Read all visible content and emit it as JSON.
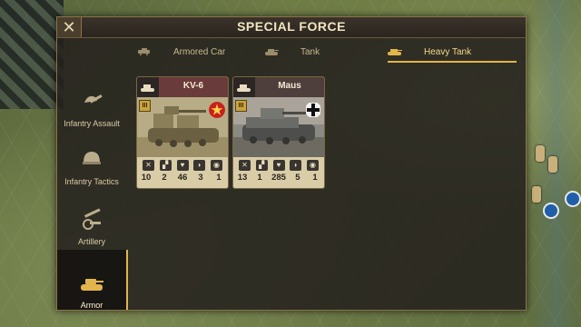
{
  "window": {
    "title": "SPECIAL FORCE",
    "close_glyph": "✕"
  },
  "tabs": [
    {
      "label": "Armored Car",
      "icon": "armored-car-icon",
      "active": false
    },
    {
      "label": "Tank",
      "icon": "tank-icon",
      "active": false
    },
    {
      "label": "Heavy Tank",
      "icon": "heavy-tank-icon",
      "active": true
    }
  ],
  "sidebar": {
    "items": [
      {
        "label": "Infantry Assault",
        "icon": "infantry-assault-icon",
        "active": false
      },
      {
        "label": "Infantry Tactics",
        "icon": "infantry-tactics-icon",
        "active": false
      },
      {
        "label": "Artillery",
        "icon": "artillery-icon",
        "active": false
      },
      {
        "label": "Armor",
        "icon": "armor-icon",
        "active": true
      }
    ]
  },
  "units": [
    {
      "name": "KV-6",
      "rank": "III",
      "nation": "soviet-star-icon",
      "stats": {
        "attack": "10",
        "movement": "2",
        "health": "46",
        "defense": "3",
        "range": "1"
      }
    },
    {
      "name": "Maus",
      "rank": "III",
      "nation": "german-cross-icon",
      "stats": {
        "attack": "13",
        "movement": "1",
        "health": "285",
        "defense": "5",
        "range": "1"
      }
    }
  ],
  "colors": {
    "accent": "#e2b44c",
    "panel": "#24211e",
    "title_text": "#f2e4c0",
    "soviet_red": "#c8201b"
  }
}
